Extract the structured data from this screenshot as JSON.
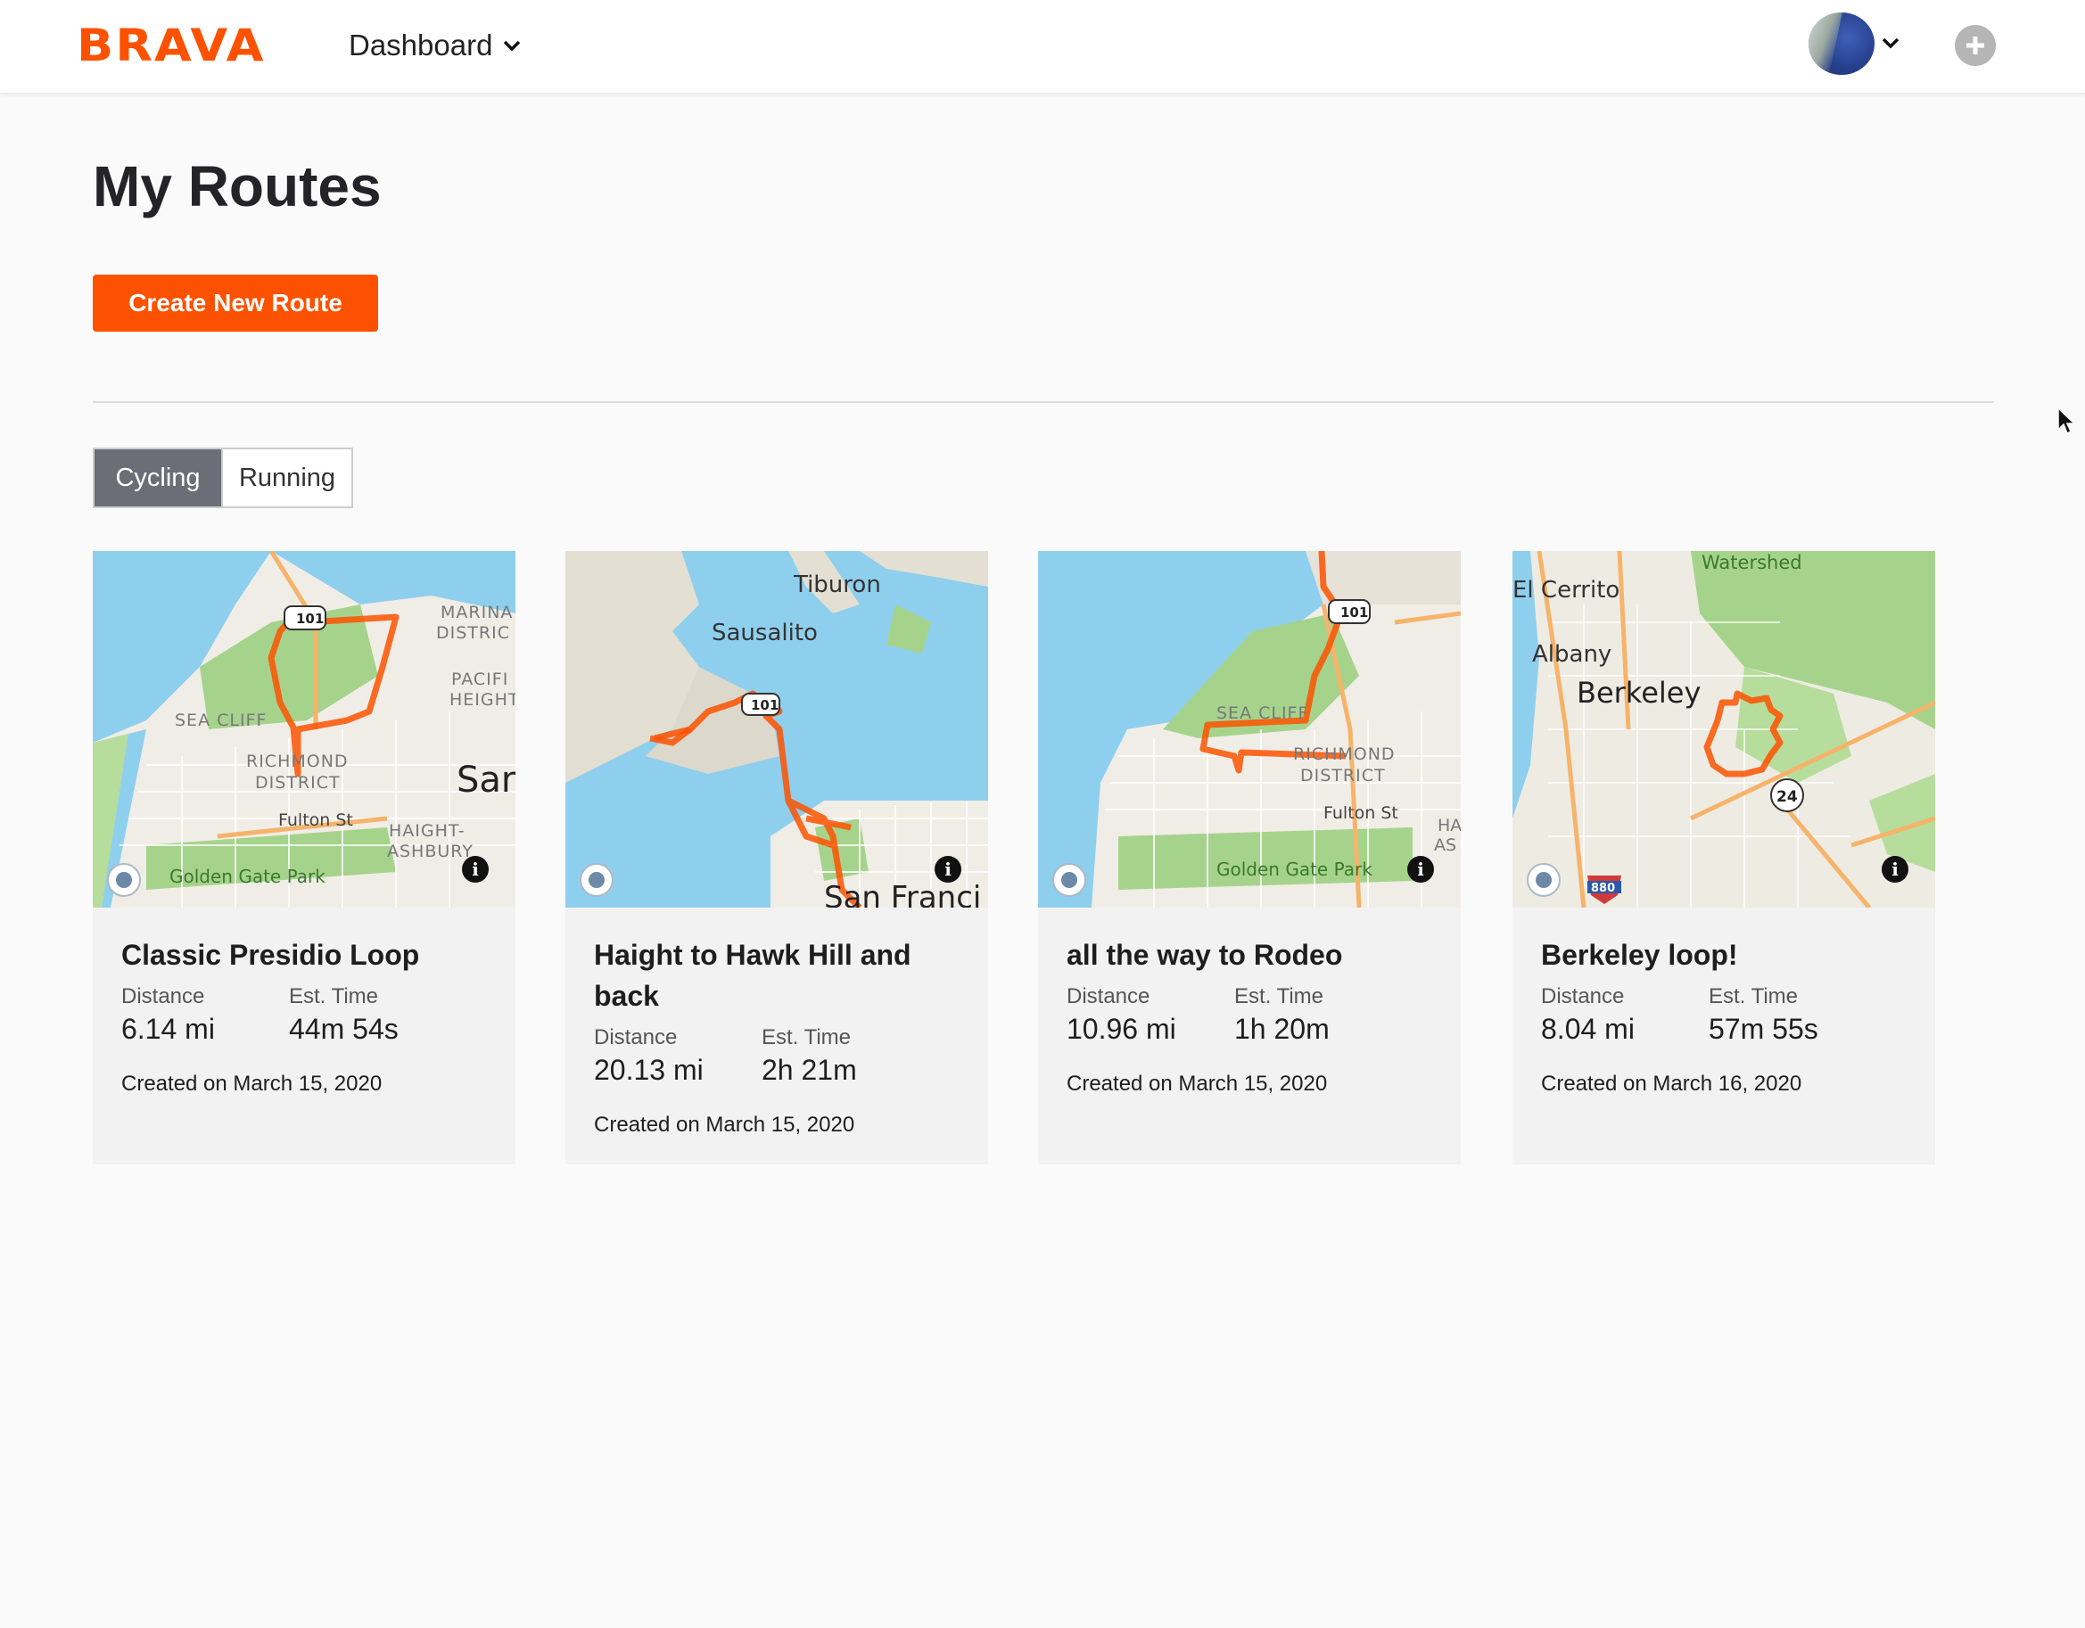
{
  "header": {
    "logo": "BRAVA",
    "nav_label": "Dashboard",
    "avatar_icon": "user-avatar",
    "add_icon": "plus-circle-icon",
    "brand_color": "#fc5200"
  },
  "page": {
    "title": "My Routes",
    "create_button": "Create New Route",
    "tabs": [
      {
        "label": "Cycling",
        "active": true
      },
      {
        "label": "Running",
        "active": false
      }
    ]
  },
  "labels": {
    "distance": "Distance",
    "time": "Est. Time"
  },
  "routes": [
    {
      "title": "Classic Presidio Loop",
      "distance": "6.14 mi",
      "time": "44m 54s",
      "created": "Created on March 15, 2020",
      "map_labels": [
        "MARINA DISTRICT",
        "PACIFIC HEIGHTS",
        "SEA CLIFF",
        "RICHMOND DISTRICT",
        "San",
        "Fulton St",
        "HAIGHT-ASHBURY",
        "Golden Gate Park",
        "101"
      ]
    },
    {
      "title": "Haight to Hawk Hill and back",
      "distance": "20.13 mi",
      "time": "2h 21m",
      "created": "Created on March 15, 2020",
      "map_labels": [
        "Tiburon",
        "Sausalito",
        "San Franci",
        "101"
      ]
    },
    {
      "title": "all the way to Rodeo",
      "distance": "10.96 mi",
      "time": "1h 20m",
      "created": "Created on March 15, 2020",
      "map_labels": [
        "SEA CLIFF",
        "RICHMOND DISTRICT",
        "Fulton St",
        "Golden Gate Park",
        "HA AS",
        "101"
      ]
    },
    {
      "title": "Berkeley loop!",
      "distance": "8.04 mi",
      "time": "57m 55s",
      "created": "Created on March 16, 2020",
      "map_labels": [
        "Watershed",
        "El Cerrito",
        "Albany",
        "Berkeley",
        "24",
        "880"
      ]
    }
  ]
}
